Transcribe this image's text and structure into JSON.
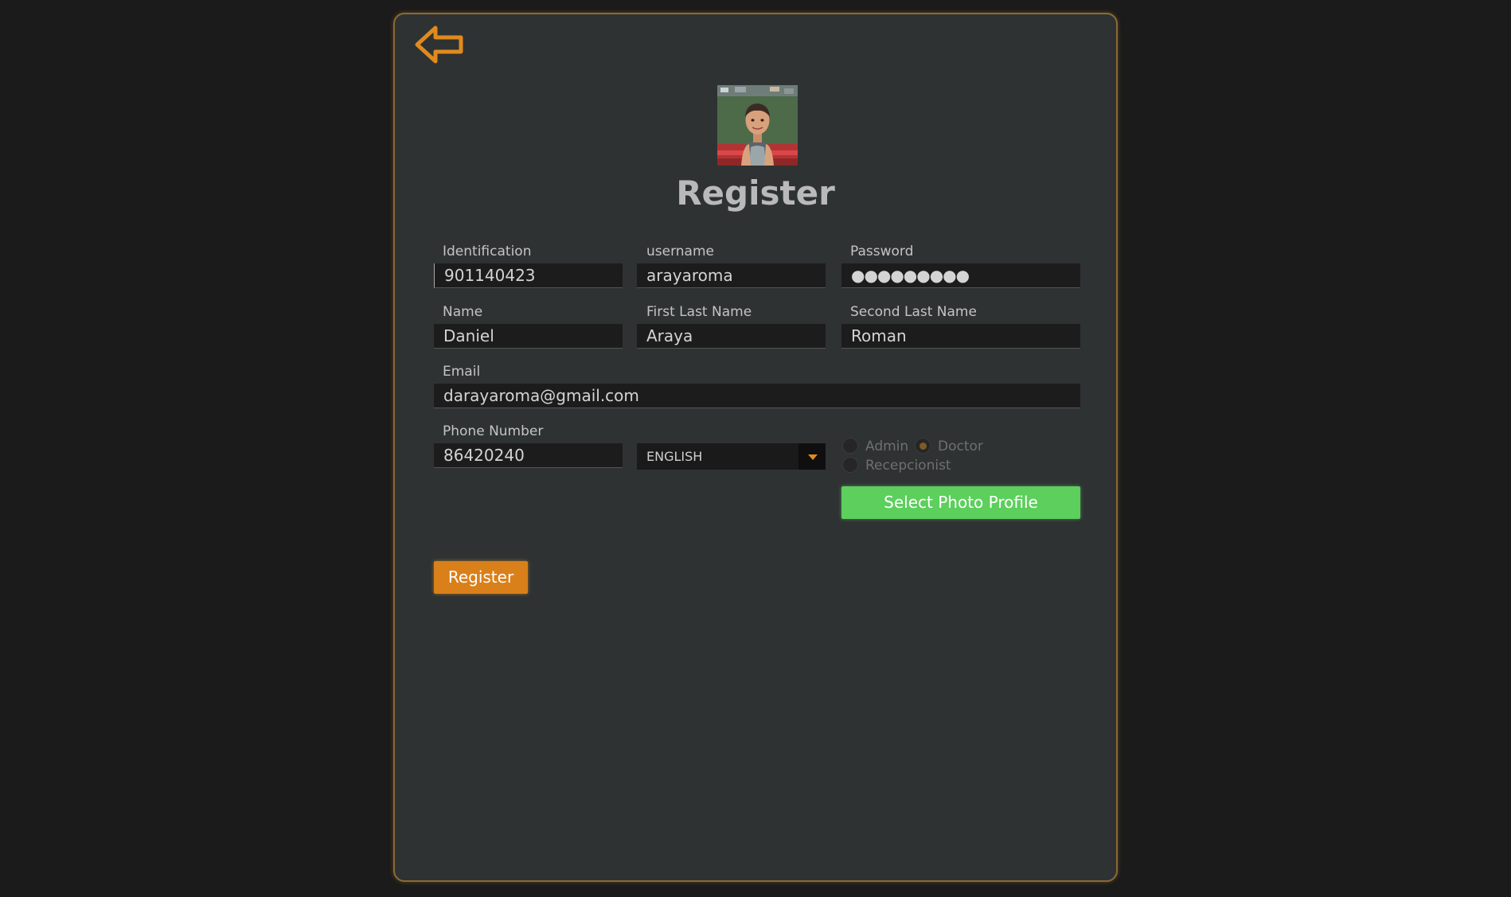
{
  "header": {
    "back_icon": "back-arrow-icon",
    "title": "Register"
  },
  "form": {
    "identification": {
      "label": "Identification",
      "value": "901140423"
    },
    "username": {
      "label": "username",
      "value": "arayaroma"
    },
    "password": {
      "label": "Password",
      "value": "●●●●●●●●●"
    },
    "name": {
      "label": "Name",
      "value": "Daniel"
    },
    "first_last_name": {
      "label": "First Last Name",
      "value": "Araya"
    },
    "second_last_name": {
      "label": "Second Last Name",
      "value": "Roman"
    },
    "email": {
      "label": "Email",
      "value": "darayaroma@gmail.com"
    },
    "phone": {
      "label": "Phone Number",
      "value": "86420240"
    },
    "language": {
      "selected": "ENGLISH"
    },
    "roles": [
      {
        "label": "Admin",
        "checked": false
      },
      {
        "label": "Doctor",
        "checked": true
      },
      {
        "label": "Recepcionist",
        "checked": false
      }
    ]
  },
  "buttons": {
    "select_photo": "Select Photo Profile",
    "register": "Register"
  },
  "colors": {
    "accent": "#e08a1e",
    "success": "#5ccf5c",
    "panel_bg": "#2e3233",
    "page_bg": "#1b1b1b"
  }
}
